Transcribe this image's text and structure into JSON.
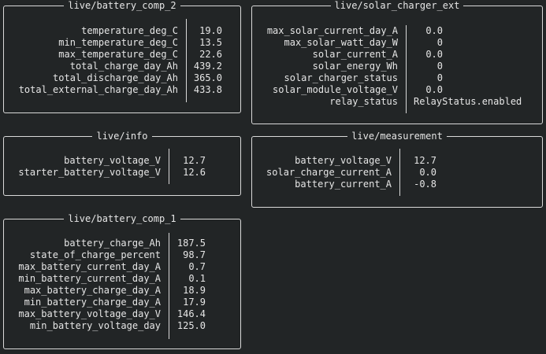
{
  "panels": {
    "battery_comp_2": {
      "title": "live/battery_comp_2",
      "rows": [
        {
          "key": "temperature_deg_C",
          "value": "19.0"
        },
        {
          "key": "min_temperature_deg_C",
          "value": "13.5"
        },
        {
          "key": "max_temperature_deg_C",
          "value": "22.6"
        },
        {
          "key": "total_charge_day_Ah",
          "value": "439.2"
        },
        {
          "key": "total_discharge_day_Ah",
          "value": "365.0"
        },
        {
          "key": "total_external_charge_day_Ah",
          "value": "433.8"
        }
      ]
    },
    "solar_charger_ext": {
      "title": "live/solar_charger_ext",
      "rows": [
        {
          "key": "max_solar_current_day_A",
          "value": "0.0"
        },
        {
          "key": "max_solar_watt_day_W",
          "value": "0"
        },
        {
          "key": "solar_current_A",
          "value": "0.0"
        },
        {
          "key": "solar_energy_Wh",
          "value": "0"
        },
        {
          "key": "solar_charger_status",
          "value": "0"
        },
        {
          "key": "solar_module_voltage_V",
          "value": "0.0"
        },
        {
          "key": "relay_status",
          "value": "RelayStatus.enabled"
        }
      ]
    },
    "info": {
      "title": "live/info",
      "rows": [
        {
          "key": "battery_voltage_V",
          "value": "12.7"
        },
        {
          "key": "starter_battery_voltage_V",
          "value": "12.6"
        }
      ]
    },
    "measurement": {
      "title": "live/measurement",
      "rows": [
        {
          "key": "battery_voltage_V",
          "value": "12.7"
        },
        {
          "key": "solar_charge_current_A",
          "value": "0.0"
        },
        {
          "key": "battery_current_A",
          "value": "-0.8"
        }
      ]
    },
    "battery_comp_1": {
      "title": "live/battery_comp_1",
      "rows": [
        {
          "key": "battery_charge_Ah",
          "value": "187.5"
        },
        {
          "key": "state_of_charge_percent",
          "value": "98.7"
        },
        {
          "key": "max_battery_current_day_A",
          "value": "0.7"
        },
        {
          "key": "min_battery_current_day_A",
          "value": "0.1"
        },
        {
          "key": "max_battery_charge_day_A",
          "value": "18.9"
        },
        {
          "key": "min_battery_charge_day_A",
          "value": "17.9"
        },
        {
          "key": "max_battery_voltage_day_V",
          "value": "146.4"
        },
        {
          "key": "min_battery_voltage_day",
          "value": "125.0"
        }
      ]
    }
  }
}
